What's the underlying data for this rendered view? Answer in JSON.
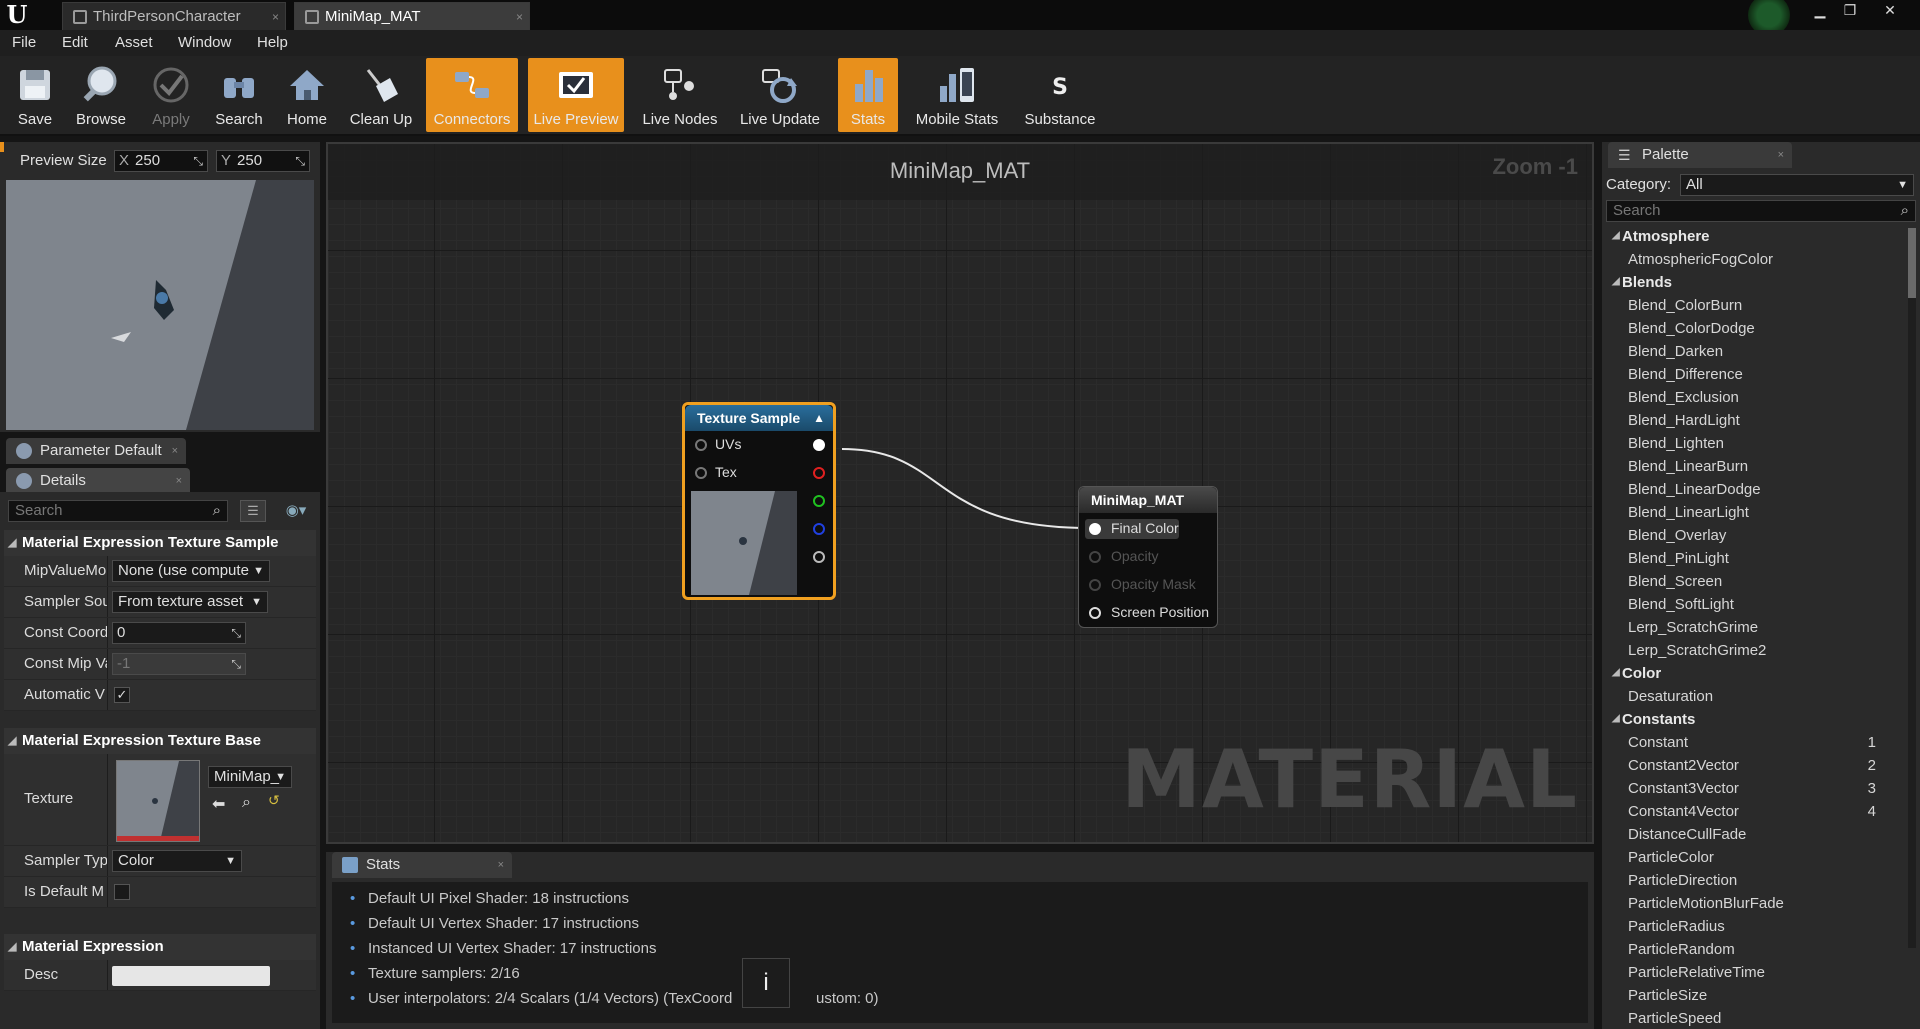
{
  "window": {
    "tabs": [
      {
        "label": "ThirdPersonCharacter",
        "active": false
      },
      {
        "label": "MiniMap_MAT",
        "active": true
      }
    ]
  },
  "menu": [
    "File",
    "Edit",
    "Asset",
    "Window",
    "Help"
  ],
  "toolbar": [
    {
      "label": "Save",
      "icon": "save-icon",
      "active": false,
      "enabled": true
    },
    {
      "label": "Browse",
      "icon": "browse-icon",
      "active": false,
      "enabled": true
    },
    {
      "label": "Apply",
      "icon": "apply-icon",
      "active": false,
      "enabled": false
    },
    {
      "label": "Search",
      "icon": "search-icon",
      "active": false,
      "enabled": true
    },
    {
      "label": "Home",
      "icon": "home-icon",
      "active": false,
      "enabled": true
    },
    {
      "label": "Clean Up",
      "icon": "cleanup-icon",
      "active": false,
      "enabled": true
    },
    {
      "label": "Connectors",
      "icon": "connectors-icon",
      "active": true,
      "enabled": true
    },
    {
      "label": "Live Preview",
      "icon": "live-preview-icon",
      "active": true,
      "enabled": true
    },
    {
      "label": "Live Nodes",
      "icon": "live-nodes-icon",
      "active": false,
      "enabled": true
    },
    {
      "label": "Live Update",
      "icon": "live-update-icon",
      "active": false,
      "enabled": true
    },
    {
      "label": "Stats",
      "icon": "stats-icon",
      "active": true,
      "enabled": true
    },
    {
      "label": "Mobile Stats",
      "icon": "mobile-stats-icon",
      "active": false,
      "enabled": true
    },
    {
      "label": "Substance",
      "icon": "substance-icon",
      "active": false,
      "enabled": true
    }
  ],
  "preview": {
    "size_label": "Preview Size",
    "x_axis": "X",
    "x_value": "250",
    "y_axis": "Y",
    "y_value": "250"
  },
  "panels": {
    "parameter_defaults": "Parameter Default",
    "details": "Details"
  },
  "details": {
    "search_placeholder": "Search",
    "sections": {
      "texture_sample": "Material Expression Texture Sample",
      "texture_base": "Material Expression Texture Base",
      "expression": "Material Expression"
    },
    "props": {
      "mip_value_mode": {
        "name": "MipValueMo",
        "value": "None (use compute"
      },
      "sampler_source": {
        "name": "Sampler Sou",
        "value": "From texture asset"
      },
      "const_coordinate": {
        "name": "Const Coordi",
        "value": "0"
      },
      "const_mip_value": {
        "name": "Const Mip Va",
        "value": "-1"
      },
      "automatic_view_mip": {
        "name": "Automatic V",
        "checked": true
      },
      "texture": {
        "name": "Texture",
        "value": "MiniMap_"
      },
      "sampler_type": {
        "name": "Sampler Typ",
        "value": "Color"
      },
      "is_default_meshpaint": {
        "name": "Is Default M",
        "checked": false
      },
      "desc": {
        "name": "Desc",
        "value": ""
      }
    }
  },
  "graph": {
    "title": "MiniMap_MAT",
    "zoom": "Zoom -1",
    "watermark": "MATERIAL",
    "texture_node": {
      "title": "Texture Sample",
      "inputs": [
        "UVs",
        "Tex"
      ],
      "output_colors": [
        "#ffffff",
        "#e02020",
        "#20c020",
        "#2040e0",
        "#bbbbbb"
      ]
    },
    "result_node": {
      "title": "MiniMap_MAT",
      "pins": [
        {
          "label": "Final Color",
          "enabled": true
        },
        {
          "label": "Opacity",
          "enabled": false
        },
        {
          "label": "Opacity Mask",
          "enabled": false
        },
        {
          "label": "Screen Position",
          "enabled": true
        }
      ]
    },
    "colors": {
      "selection": "#f0a020",
      "texture_header": "#1f5a82",
      "result_header": "#3a3a3a"
    }
  },
  "stats": {
    "tab": "Stats",
    "lines": [
      "Default UI Pixel Shader: 18 instructions",
      "Default UI Vertex Shader: 17 instructions",
      "Instanced UI Vertex Shader: 17 instructions",
      "Texture samplers: 2/16",
      "User interpolators: 2/4 Scalars (1/4 Vectors) (TexCoord",
      "ustom: 0)"
    ],
    "tooltip": "i"
  },
  "palette": {
    "tab": "Palette",
    "category_label": "Category:",
    "category_value": "All",
    "search_placeholder": "Search",
    "entries": [
      {
        "type": "cat",
        "label": "Atmosphere"
      },
      {
        "type": "item",
        "label": "AtmosphericFogColor"
      },
      {
        "type": "cat",
        "label": "Blends"
      },
      {
        "type": "item",
        "label": "Blend_ColorBurn"
      },
      {
        "type": "item",
        "label": "Blend_ColorDodge"
      },
      {
        "type": "item",
        "label": "Blend_Darken"
      },
      {
        "type": "item",
        "label": "Blend_Difference"
      },
      {
        "type": "item",
        "label": "Blend_Exclusion"
      },
      {
        "type": "item",
        "label": "Blend_HardLight"
      },
      {
        "type": "item",
        "label": "Blend_Lighten"
      },
      {
        "type": "item",
        "label": "Blend_LinearBurn"
      },
      {
        "type": "item",
        "label": "Blend_LinearDodge"
      },
      {
        "type": "item",
        "label": "Blend_LinearLight"
      },
      {
        "type": "item",
        "label": "Blend_Overlay"
      },
      {
        "type": "item",
        "label": "Blend_PinLight"
      },
      {
        "type": "item",
        "label": "Blend_Screen"
      },
      {
        "type": "item",
        "label": "Blend_SoftLight"
      },
      {
        "type": "item",
        "label": "Lerp_ScratchGrime"
      },
      {
        "type": "item",
        "label": "Lerp_ScratchGrime2"
      },
      {
        "type": "cat",
        "label": "Color"
      },
      {
        "type": "item",
        "label": "Desaturation"
      },
      {
        "type": "cat",
        "label": "Constants"
      },
      {
        "type": "item",
        "label": "Constant",
        "hotkey": "1"
      },
      {
        "type": "item",
        "label": "Constant2Vector",
        "hotkey": "2"
      },
      {
        "type": "item",
        "label": "Constant3Vector",
        "hotkey": "3"
      },
      {
        "type": "item",
        "label": "Constant4Vector",
        "hotkey": "4"
      },
      {
        "type": "item",
        "label": "DistanceCullFade"
      },
      {
        "type": "item",
        "label": "ParticleColor"
      },
      {
        "type": "item",
        "label": "ParticleDirection"
      },
      {
        "type": "item",
        "label": "ParticleMotionBlurFade"
      },
      {
        "type": "item",
        "label": "ParticleRadius"
      },
      {
        "type": "item",
        "label": "ParticleRandom"
      },
      {
        "type": "item",
        "label": "ParticleRelativeTime"
      },
      {
        "type": "item",
        "label": "ParticleSize"
      },
      {
        "type": "item",
        "label": "ParticleSpeed"
      }
    ]
  }
}
